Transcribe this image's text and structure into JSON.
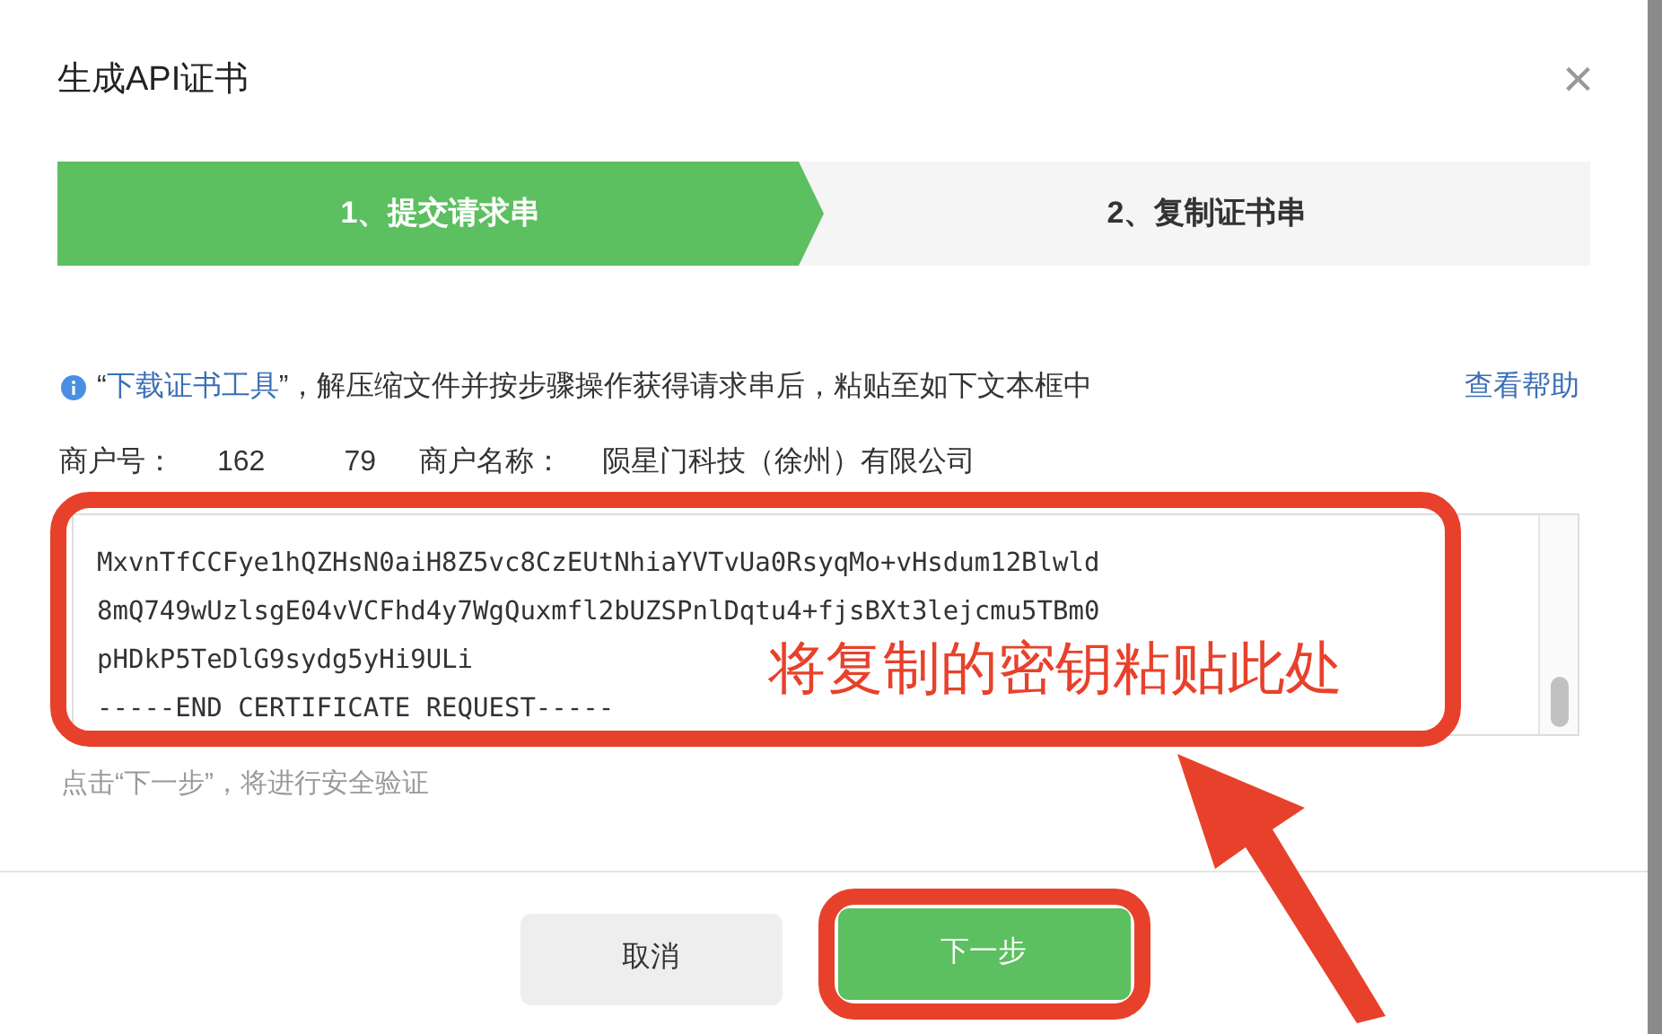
{
  "dialog": {
    "title": "生成API证书",
    "close": "×"
  },
  "steps": [
    {
      "label": "1、提交请求串",
      "selected": true
    },
    {
      "label": "2、复制证书串",
      "selected": false
    }
  ],
  "notice": {
    "quote_open": "“",
    "link": "下载证书工具",
    "text": "”，解压缩文件并按步骤操作获得请求串后，粘贴至如下文本框中",
    "help": "查看帮助"
  },
  "merchant": {
    "id_label": "商户号：",
    "id_start": "162",
    "id_end": "79",
    "name_label": "商户名称：",
    "name": "陨星门科技（徐州）有限公司"
  },
  "request_box": {
    "lines": [
      "MxvnTfCCFye1hQZHsN0aiH8Z5vc8CzEUtNhiaYVTvUa0RsyqMo+vHsdum12Blwld",
      "8mQ749wUzlsgE04vVCFhd4y7WgQuxmfl2bUZSPnlDqtu4+fjsBXt3lejcmu5TBm0",
      "pHDkP5TeDlG9sydg5yHi9ULi",
      "-----END CERTIFICATE REQUEST-----"
    ]
  },
  "hint": "点击“下一步”，将进行安全验证",
  "buttons": [
    {
      "label": "取消",
      "kind": "secondary"
    },
    {
      "label": "下一步",
      "kind": "primary"
    }
  ],
  "annotation": {
    "text": "将复制的密钥粘贴此处"
  }
}
